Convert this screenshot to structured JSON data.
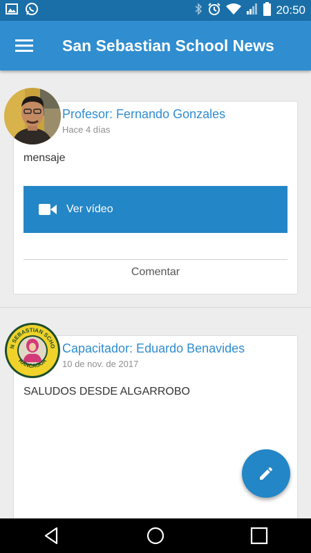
{
  "status_bar": {
    "time": "20:50",
    "left_icons": [
      "gallery-icon",
      "whatsapp-icon"
    ],
    "right_icons": [
      "bluetooth-icon",
      "alarm-icon",
      "wifi-icon",
      "signal-icon",
      "battery-icon"
    ]
  },
  "app_bar": {
    "title": "San Sebastian School News",
    "menu_icon": "hamburger-menu-icon"
  },
  "posts": [
    {
      "author": "Profesor: Fernando Gonzales",
      "time": "Hace 4 días",
      "message": "mensaje",
      "video_label": "Ver vídeo",
      "comment_label": "Comentar"
    },
    {
      "author": "Capacitador: Eduardo Benavides",
      "time": "10 de nov. de 2017",
      "message": "SALUDOS DESDE ALGARROBO",
      "logo_text_top": "SAN SEBASTIAN SCHOOL",
      "logo_text_bottom": "RANCAGUA"
    }
  ],
  "fab": {
    "icon": "pencil-icon"
  },
  "nav_bar": {
    "icons": [
      "back-icon",
      "home-icon",
      "recents-icon"
    ]
  },
  "colors": {
    "status_bar": "#1a6fa8",
    "app_bar": "#2f8dd0",
    "accent": "#2386c6",
    "author_text": "#2f8dd0"
  }
}
